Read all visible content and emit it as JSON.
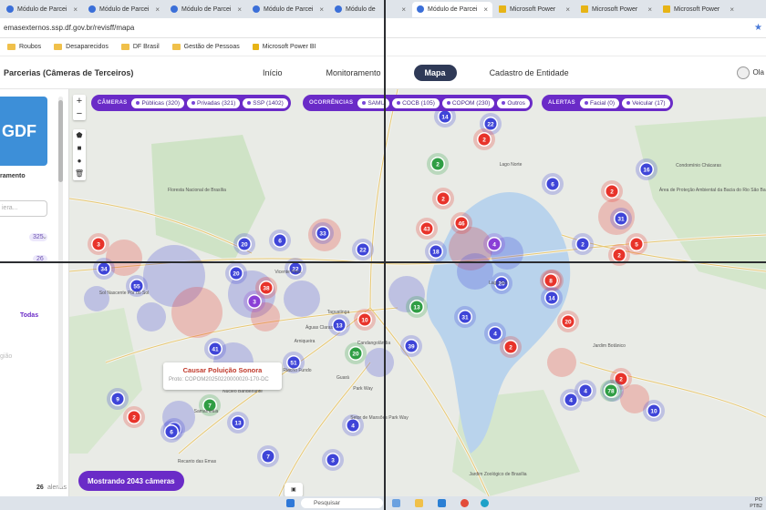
{
  "browser": {
    "tabs": [
      {
        "label": "Módulo de Parcei",
        "active": false,
        "icon": "globe-icon"
      },
      {
        "label": "Módulo de Parcei",
        "active": false,
        "icon": "globe-icon"
      },
      {
        "label": "Módulo de Parcei",
        "active": false,
        "icon": "globe-icon"
      },
      {
        "label": "Módulo de Parcei",
        "active": false,
        "icon": "globe-icon"
      },
      {
        "label": "Módulo de",
        "active": false,
        "icon": "globe-icon"
      },
      {
        "label": "Módulo de Parcei",
        "active": true,
        "icon": "globe-icon"
      },
      {
        "label": "Microsoft Power",
        "active": false,
        "icon": "powerbi-icon"
      },
      {
        "label": "Microsoft Power",
        "active": false,
        "icon": "powerbi-icon"
      },
      {
        "label": "Microsoft Power",
        "active": false,
        "icon": "powerbi-icon"
      }
    ],
    "url": "emasexternos.ssp.df.gov.br/revisff/mapa",
    "bookmarks": [
      "Roubos",
      "Desaparecidos",
      "DF Brasil",
      "Gestão de Pessoas",
      "Microsoft Power BI"
    ]
  },
  "app": {
    "title": "Parcerias (Câmeras de Terceiros)",
    "nav": [
      {
        "label": "Início",
        "active": false
      },
      {
        "label": "Monitoramento",
        "active": false
      },
      {
        "label": "Mapa",
        "active": true
      },
      {
        "label": "Cadastro de Entidade",
        "active": false
      }
    ],
    "user_name": "Ola"
  },
  "sidebar": {
    "logo_text": "GDF",
    "section_label": "ramento",
    "field_placeholder": "iera...",
    "count_a": "325",
    "count_b": "26",
    "link_all": "Todas",
    "gray_text": "gião",
    "bottom_count": "26",
    "bottom_label": "alertas"
  },
  "filters": {
    "cameras_label": "CÂMERAS",
    "cameras": [
      "Públicas (320)",
      "Privadas (321)",
      "SSP (1402)"
    ],
    "ocorrencias_label": "OCORRÊNCIAS",
    "ocorrencias": [
      "SAMU",
      "COCB (105)",
      "COPOM (230)",
      "Outros"
    ],
    "alertas_label": "ALERTAS",
    "alertas": [
      "Facial (0)",
      "Veicular (17)"
    ]
  },
  "popup": {
    "title": "Causar Poluição Sonora",
    "subtitle": "Proto: COPOM20250220000020-170-DC"
  },
  "map_labels": [
    "Floresta Nacional de Brasília",
    "Vicente Pires",
    "Taguatinga",
    "Águas Claras",
    "Arniqueira",
    "Riacho Fundo",
    "Candangolândia",
    "Park Way",
    "Lago Sul",
    "Lago Norte",
    "Jardim Botânico",
    "Núcleo Bandeirante",
    "Recanto das Emas",
    "Samambaia",
    "Condomínio Chácaras",
    "Área de Proteção Ambiental da Bacia do Rio São Bartolomeu",
    "Sol Nascente Pôr do Sol",
    "Setor de Mansões Park Way",
    "Jardim Zoológico de Brasília",
    "Guará"
  ],
  "clusters": [
    {
      "n": "14",
      "c": "blue"
    },
    {
      "n": "22",
      "c": "blue"
    },
    {
      "n": "2",
      "c": "red"
    },
    {
      "n": "2",
      "c": "green"
    },
    {
      "n": "2",
      "c": "red"
    },
    {
      "n": "3",
      "c": "red"
    },
    {
      "n": "20",
      "c": "blue"
    },
    {
      "n": "6",
      "c": "blue"
    },
    {
      "n": "33",
      "c": "blue"
    },
    {
      "n": "22",
      "c": "blue"
    },
    {
      "n": "43",
      "c": "red"
    },
    {
      "n": "46",
      "c": "red"
    },
    {
      "n": "18",
      "c": "blue"
    },
    {
      "n": "4",
      "c": "purple"
    },
    {
      "n": "2",
      "c": "blue"
    },
    {
      "n": "6",
      "c": "blue"
    },
    {
      "n": "16",
      "c": "blue"
    },
    {
      "n": "2",
      "c": "red"
    },
    {
      "n": "31",
      "c": "blue"
    },
    {
      "n": "5",
      "c": "red"
    },
    {
      "n": "2",
      "c": "red"
    },
    {
      "n": "34",
      "c": "blue"
    },
    {
      "n": "20",
      "c": "blue"
    },
    {
      "n": "22",
      "c": "blue"
    },
    {
      "n": "55",
      "c": "blue"
    },
    {
      "n": "38",
      "c": "red"
    },
    {
      "n": "3",
      "c": "purple"
    },
    {
      "n": "2",
      "c": "red"
    },
    {
      "n": "8",
      "c": "red"
    },
    {
      "n": "20",
      "c": "blue"
    },
    {
      "n": "14",
      "c": "blue"
    },
    {
      "n": "20",
      "c": "red"
    },
    {
      "n": "13",
      "c": "blue"
    },
    {
      "n": "13",
      "c": "green"
    },
    {
      "n": "10",
      "c": "red"
    },
    {
      "n": "31",
      "c": "blue"
    },
    {
      "n": "41",
      "c": "blue"
    },
    {
      "n": "51",
      "c": "blue"
    },
    {
      "n": "4",
      "c": "blue"
    },
    {
      "n": "2",
      "c": "red"
    },
    {
      "n": "39",
      "c": "blue"
    },
    {
      "n": "6",
      "c": "blue"
    },
    {
      "n": "20",
      "c": "green"
    },
    {
      "n": "9",
      "c": "blue"
    },
    {
      "n": "2",
      "c": "red"
    },
    {
      "n": "7",
      "c": "green"
    },
    {
      "n": "13",
      "c": "blue"
    },
    {
      "n": "6",
      "c": "blue"
    },
    {
      "n": "4",
      "c": "blue"
    },
    {
      "n": "7",
      "c": "blue"
    },
    {
      "n": "3",
      "c": "blue"
    },
    {
      "n": "4",
      "c": "blue"
    },
    {
      "n": "2",
      "c": "red"
    },
    {
      "n": "10",
      "c": "blue"
    },
    {
      "n": "4",
      "c": "blue"
    },
    {
      "n": "78",
      "c": "green"
    },
    {
      "n": "10",
      "c": "blue"
    }
  ],
  "status": {
    "showing": "Mostrando 2043 câmeras"
  },
  "taskbar": {
    "search": "Pesquisar",
    "clock_top": "PO",
    "clock_bottom": "PTB2"
  },
  "colors": {
    "accent_purple": "#6a2bc7",
    "cluster_blue": "#3f45d8",
    "cluster_red": "#e8332a",
    "cluster_green": "#2f9e44",
    "nav_active": "#2f3a57"
  }
}
